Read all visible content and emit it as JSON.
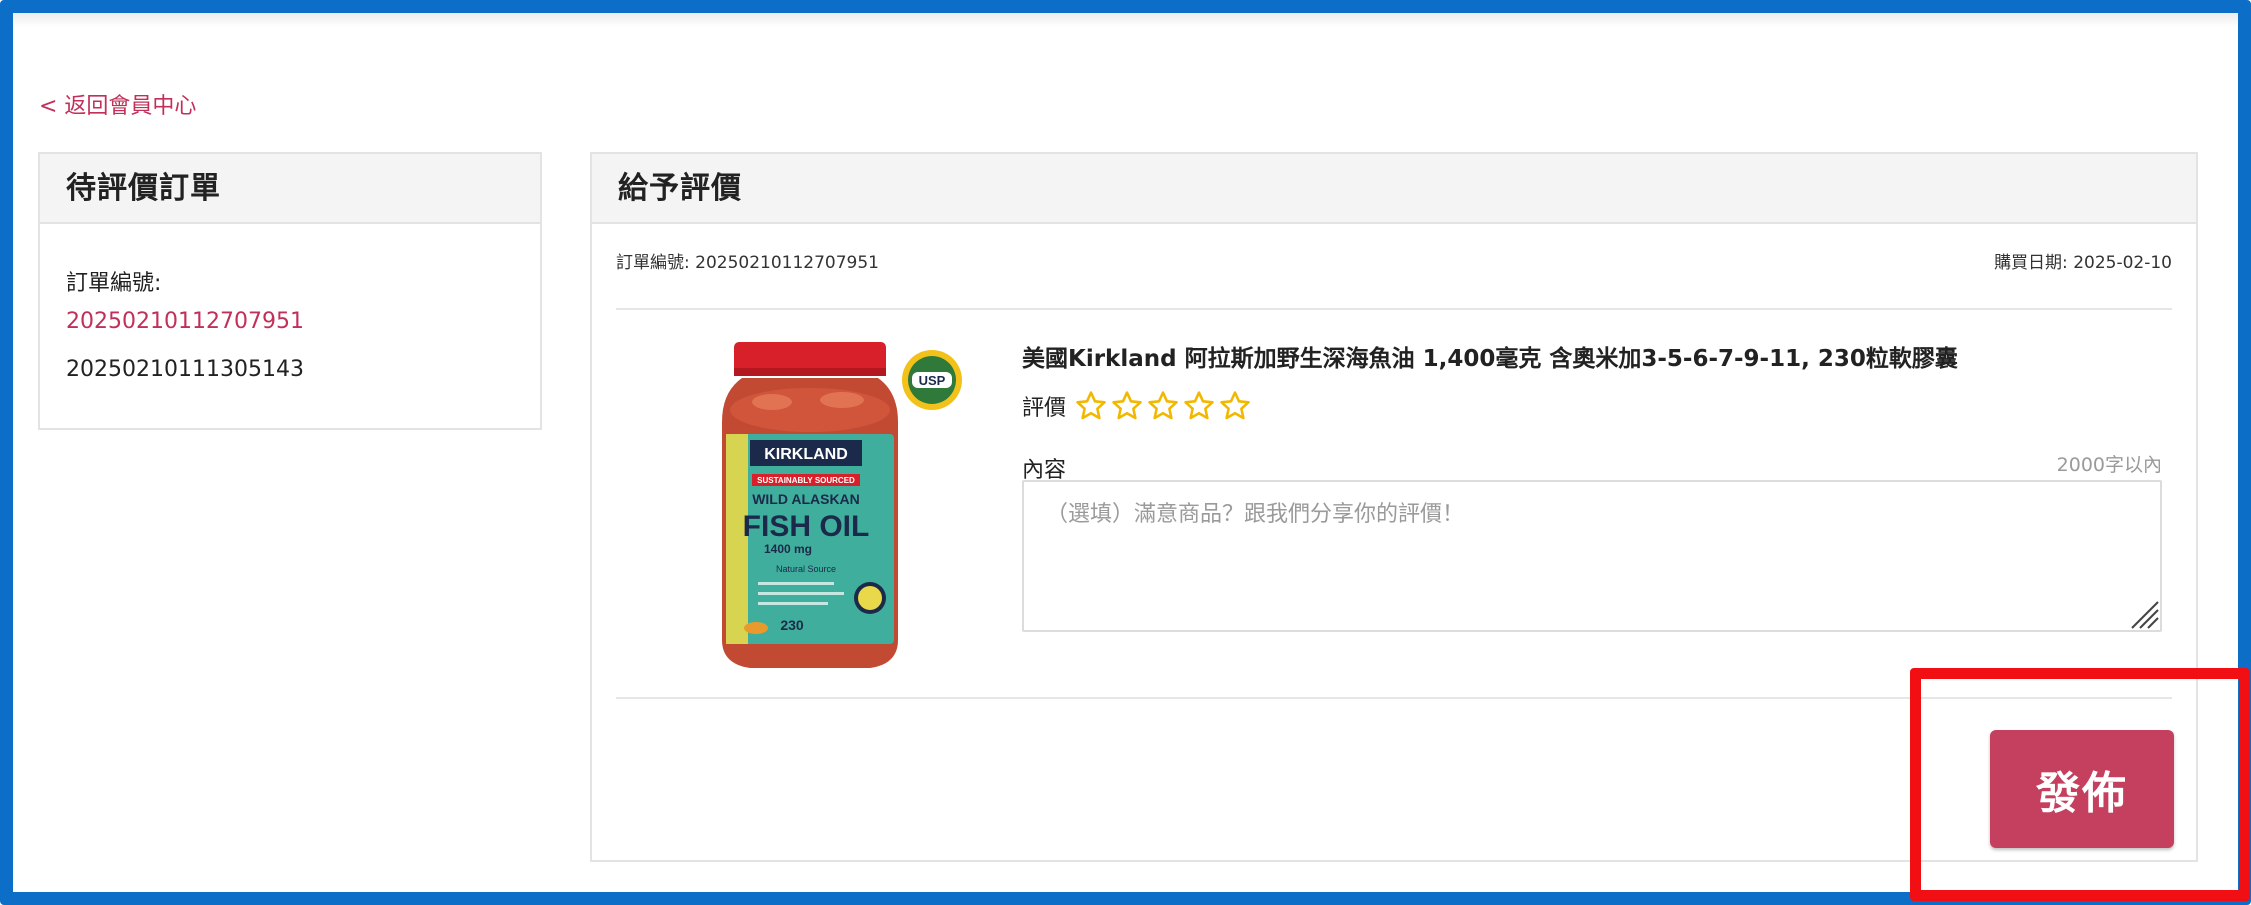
{
  "nav": {
    "back_link": "< 返回會員中心"
  },
  "pending_orders": {
    "title": "待評價訂單",
    "order_label": "訂單編號:",
    "orders": [
      "20250210112707951",
      "20250210111305143"
    ]
  },
  "review": {
    "title": "給予評價",
    "order_no_text": "訂單編號: 20250210112707951",
    "purchase_date_text": "購買日期: 2025-02-10",
    "product": {
      "name": "美國Kirkland 阿拉斯加野生深海魚油 1,400毫克 含奧米加3-5-6-7-9-11, 230粒軟膠囊",
      "image_text": {
        "brand": "KIRKLAND",
        "tagline": "SUSTAINABLY SOURCED",
        "line1": "WILD ALASKAN",
        "line2": "FISH OIL",
        "dose": "1400 mg",
        "source": "Natural Source",
        "count": "230",
        "seal": "USP"
      }
    },
    "rating_label": "評價",
    "rating_value": 0,
    "rating_max": 5,
    "content_label": "內容",
    "char_limit": "2000字以內",
    "placeholder": "（選填）滿意商品？跟我們分享你的評價！",
    "publish_label": "發佈"
  },
  "colors": {
    "frame_border": "#0d6ec7",
    "accent": "#c2305a",
    "button_bg": "#c5405e",
    "highlight_box": "#f20f14",
    "star": "#f2b800"
  }
}
